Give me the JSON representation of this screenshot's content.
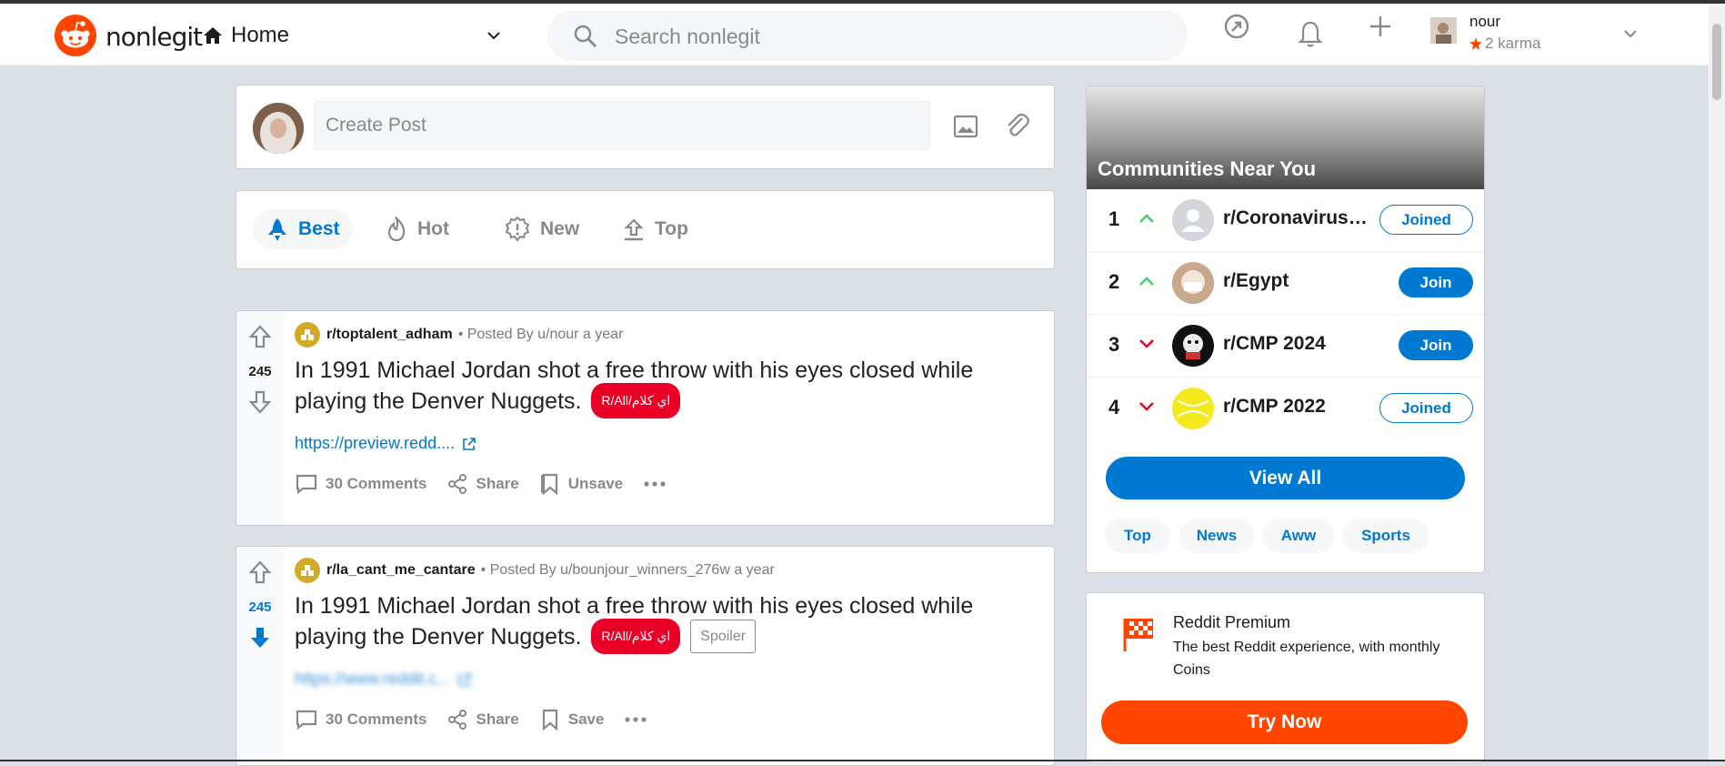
{
  "header": {
    "brand": "nonlegit",
    "home_label": "Home",
    "search_placeholder": "Search nonlegit",
    "user": {
      "name": "nour",
      "karma": "2 karma"
    }
  },
  "create_post": {
    "placeholder": "Create Post"
  },
  "sort": {
    "items": [
      {
        "label": "Best",
        "active": true
      },
      {
        "label": "Hot",
        "active": false
      },
      {
        "label": "New",
        "active": false
      },
      {
        "label": "Top",
        "active": false
      }
    ]
  },
  "posts": [
    {
      "subreddit": "r/toptalent_adham",
      "meta": "• Posted By u/nour a year",
      "votes": "245",
      "title": "In 1991 Michael Jordan shot a free throw with his eyes closed while playing the Denver Nuggets.",
      "flair": "اي كلام/R/All",
      "link": "https://preview.redd....",
      "comments": "30 Comments",
      "share": "Share",
      "save": "Unsave"
    },
    {
      "subreddit": "r/la_cant_me_cantare",
      "meta": "• Posted By u/bounjour_winners_276w a year",
      "votes": "245",
      "title": "In 1991 Michael Jordan shot a free throw with his eyes closed while playing the Denver Nuggets.",
      "flair": "اي كلام/R/All",
      "spoiler": "Spoiler",
      "link": "https://www.reddit.c...",
      "comments": "30 Comments",
      "share": "Share",
      "save": "Save"
    }
  ],
  "communities": {
    "title": "Communities Near You",
    "items": [
      {
        "rank": "1",
        "trend": "up",
        "name": "r/Coronavirus…",
        "action": "Joined"
      },
      {
        "rank": "2",
        "trend": "up",
        "name": "r/Egypt",
        "action": "Join"
      },
      {
        "rank": "3",
        "trend": "down",
        "name": "r/CMP 2024",
        "action": "Join"
      },
      {
        "rank": "4",
        "trend": "down",
        "name": "r/CMP 2022",
        "action": "Joined"
      }
    ],
    "view_all": "View All",
    "chips": [
      "Top",
      "News",
      "Aww",
      "Sports"
    ]
  },
  "premium": {
    "title": "Reddit Premium",
    "desc": "The best Reddit experience, with monthly Coins",
    "button": "Try Now"
  },
  "colors": {
    "brand": "#ff4500",
    "accent": "#0079d3",
    "flair": "#ea0027",
    "upvote_trend": "#46d160",
    "downvote_trend": "#ea0027"
  }
}
